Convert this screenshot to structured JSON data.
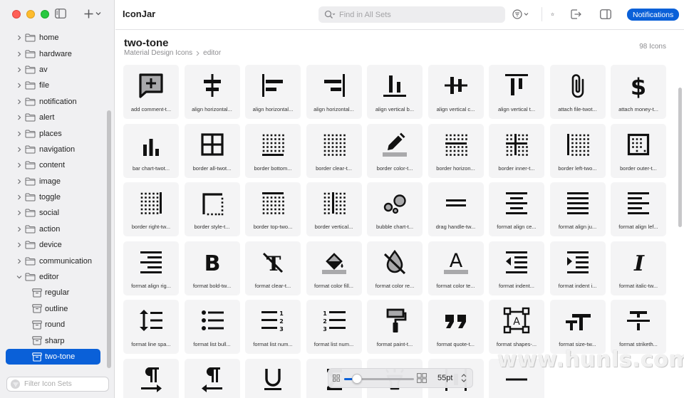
{
  "app": {
    "title": "IconJar"
  },
  "toolbar": {
    "search_placeholder": "Find in All Sets",
    "notifications_label": "Notifications",
    "colors": {
      "accent": "#0a60d8"
    }
  },
  "sidebar": {
    "folders": [
      {
        "label": "home"
      },
      {
        "label": "hardware"
      },
      {
        "label": "av"
      },
      {
        "label": "file"
      },
      {
        "label": "notification"
      },
      {
        "label": "alert"
      },
      {
        "label": "places"
      },
      {
        "label": "navigation"
      },
      {
        "label": "content"
      },
      {
        "label": "image"
      },
      {
        "label": "toggle"
      },
      {
        "label": "social"
      },
      {
        "label": "action"
      },
      {
        "label": "device"
      },
      {
        "label": "communication"
      },
      {
        "label": "editor",
        "expanded": true
      }
    ],
    "sets": [
      {
        "label": "regular"
      },
      {
        "label": "outline"
      },
      {
        "label": "round"
      },
      {
        "label": "sharp"
      },
      {
        "label": "two-tone",
        "selected": true
      }
    ],
    "filter_placeholder": "Filter Icon Sets"
  },
  "header": {
    "title": "two-tone",
    "breadcrumb": [
      "Material Design Icons",
      "editor"
    ],
    "count": "98 Icons"
  },
  "icons": [
    {
      "label": "add comment-t...",
      "icon": "add-comment-icon"
    },
    {
      "label": "align horizontal...",
      "icon": "align-horizontal-center-icon"
    },
    {
      "label": "align horizontal...",
      "icon": "align-horizontal-left-icon"
    },
    {
      "label": "align horizontal...",
      "icon": "align-horizontal-right-icon"
    },
    {
      "label": "align vertical b...",
      "icon": "align-vertical-bottom-icon"
    },
    {
      "label": "align vertical c...",
      "icon": "align-vertical-center-icon"
    },
    {
      "label": "align vertical t...",
      "icon": "align-vertical-top-icon"
    },
    {
      "label": "attach file-twot...",
      "icon": "attach-file-icon"
    },
    {
      "label": "attach money-t...",
      "icon": "attach-money-icon"
    },
    {
      "label": "bar chart-twot...",
      "icon": "bar-chart-icon"
    },
    {
      "label": "border all-twot...",
      "icon": "border-all-icon"
    },
    {
      "label": "border bottom...",
      "icon": "border-bottom-icon"
    },
    {
      "label": "border clear-t...",
      "icon": "border-clear-icon"
    },
    {
      "label": "border color-t...",
      "icon": "border-color-icon"
    },
    {
      "label": "border horizon...",
      "icon": "border-horizontal-icon"
    },
    {
      "label": "border inner-t...",
      "icon": "border-inner-icon"
    },
    {
      "label": "border left-two...",
      "icon": "border-left-icon"
    },
    {
      "label": "border outer-t...",
      "icon": "border-outer-icon"
    },
    {
      "label": "border right-tw...",
      "icon": "border-right-icon"
    },
    {
      "label": "border style-t...",
      "icon": "border-style-icon"
    },
    {
      "label": "border top-two...",
      "icon": "border-top-icon"
    },
    {
      "label": "border vertical...",
      "icon": "border-vertical-icon"
    },
    {
      "label": "bubble chart-t...",
      "icon": "bubble-chart-icon"
    },
    {
      "label": "drag handle-tw...",
      "icon": "drag-handle-icon"
    },
    {
      "label": "format align ce...",
      "icon": "format-align-center-icon"
    },
    {
      "label": "format align ju...",
      "icon": "format-align-justify-icon"
    },
    {
      "label": "format align lef...",
      "icon": "format-align-left-icon"
    },
    {
      "label": "format align rig...",
      "icon": "format-align-right-icon"
    },
    {
      "label": "format bold-tw...",
      "icon": "format-bold-icon"
    },
    {
      "label": "format clear-t...",
      "icon": "format-clear-icon"
    },
    {
      "label": "format color fill...",
      "icon": "format-color-fill-icon"
    },
    {
      "label": "format color re...",
      "icon": "format-color-reset-icon"
    },
    {
      "label": "format color te...",
      "icon": "format-color-text-icon"
    },
    {
      "label": "format indent...",
      "icon": "format-indent-decrease-icon"
    },
    {
      "label": "format indent i...",
      "icon": "format-indent-increase-icon"
    },
    {
      "label": "format italic-tw...",
      "icon": "format-italic-icon"
    },
    {
      "label": "format line spa...",
      "icon": "format-line-spacing-icon"
    },
    {
      "label": "format list bull...",
      "icon": "format-list-bulleted-icon"
    },
    {
      "label": "format list num...",
      "icon": "format-list-numbered-rtl-icon"
    },
    {
      "label": "format list num...",
      "icon": "format-list-numbered-icon"
    },
    {
      "label": "format paint-t...",
      "icon": "format-paint-icon"
    },
    {
      "label": "format quote-t...",
      "icon": "format-quote-icon"
    },
    {
      "label": "format shapes-...",
      "icon": "format-shapes-icon"
    },
    {
      "label": "format size-tw...",
      "icon": "format-size-icon"
    },
    {
      "label": "format striketh...",
      "icon": "format-strikethrough-icon"
    },
    {
      "label": "",
      "icon": "format-textdirection-l-to-r-icon"
    },
    {
      "label": "",
      "icon": "format-textdirection-r-to-l-icon"
    },
    {
      "label": "",
      "icon": "format-underlined-icon"
    },
    {
      "label": "",
      "icon": "functions-icon"
    },
    {
      "label": "",
      "icon": "highlight-icon"
    },
    {
      "label": "",
      "icon": "horizontal-distribute-icon"
    },
    {
      "label": "",
      "icon": "horizontal-rule-icon"
    }
  ],
  "zoom": {
    "value_label": "55pt",
    "level": 0.18
  },
  "watermark": "www.hunls.com"
}
